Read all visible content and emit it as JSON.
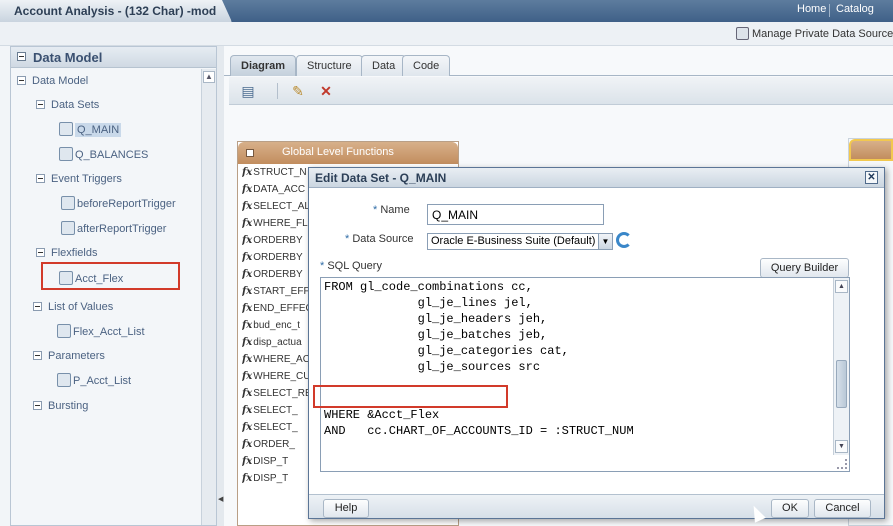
{
  "topbar": {
    "title": "Account Analysis - (132 Char) -mod",
    "links": [
      "Home",
      "Catalog"
    ]
  },
  "subbar": {
    "manage_link": "Manage Private Data Sources"
  },
  "left_panel": {
    "title": "Data Model",
    "tree": {
      "root": "Data Model",
      "data_sets_label": "Data Sets",
      "data_sets": [
        "Q_MAIN",
        "Q_BALANCES"
      ],
      "event_triggers_label": "Event Triggers",
      "event_triggers": [
        "beforeReportTrigger",
        "afterReportTrigger"
      ],
      "flexfields_label": "Flexfields",
      "flexfields": [
        "Acct_Flex"
      ],
      "lov_label": "List of Values",
      "lov": [
        "Flex_Acct_List"
      ],
      "parameters_label": "Parameters",
      "parameters": [
        "P_Acct_List"
      ],
      "bursting_label": "Bursting"
    }
  },
  "main": {
    "tabs": [
      "Diagram",
      "Structure",
      "Data",
      "Code"
    ],
    "active_tab": "Diagram",
    "glf_panel": {
      "title": "Global Level Functions",
      "rows": [
        "STRUCT_N",
        "DATA_ACC",
        "SELECT_AL",
        "WHERE_FL",
        "ORDERBY",
        "ORDERBY",
        "ORDERBY",
        "START_EFF",
        "END_EFFEC",
        "bud_enc_t",
        "disp_actua",
        "WHERE_AC",
        "WHERE_CU",
        "SELECT_RE",
        "SELECT_",
        "SELECT_",
        "ORDER_",
        "DISP_T",
        "DISP_T"
      ]
    }
  },
  "dialog": {
    "title": "Edit Data Set - Q_MAIN",
    "close_glyph": "✕",
    "required_mark": "*",
    "name_label": "Name",
    "name_value": "Q_MAIN",
    "data_source_label": "Data Source",
    "data_source_value": "Oracle E-Business Suite (Default)",
    "sql_label": "SQL Query",
    "query_builder_label": "Query Builder",
    "sql_lines": [
      "FROM gl_code_combinations cc,",
      "             gl_je_lines jel,",
      "             gl_je_headers jeh,",
      "             gl_je_batches jeb,",
      "             gl_je_categories cat,",
      "             gl_je_sources src",
      "",
      "",
      "WHERE &Acct_Flex",
      "AND   cc.CHART_OF_ACCOUNTS_ID = :STRUCT_NUM"
    ],
    "help_label": "Help",
    "ok_label": "OK",
    "cancel_label": "Cancel"
  },
  "colors": {
    "topbar": "#4a6b92",
    "highlight_box": "#d23a2a",
    "panel_header_orange": "#c28d5e",
    "link_blue": "#4b6282"
  }
}
